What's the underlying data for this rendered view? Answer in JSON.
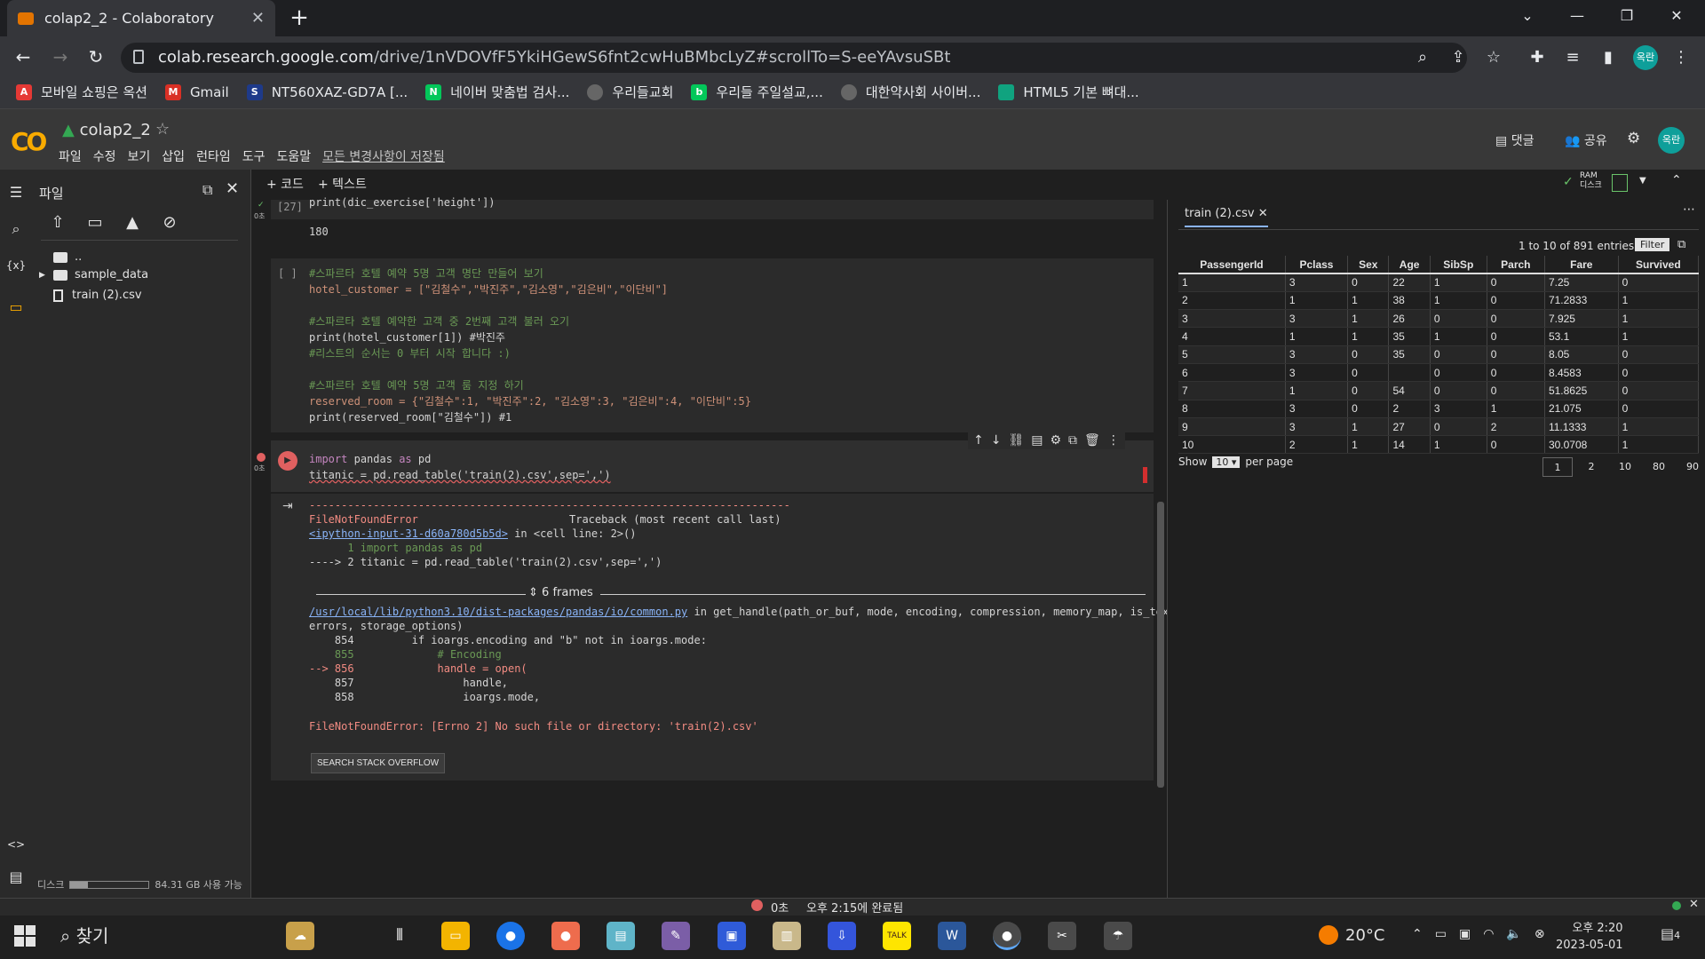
{
  "browser": {
    "tab_title": "colap2_2 - Colaboratory",
    "url_host": "colab.research.google.com",
    "url_path": "/drive/1nVDOVfF5YkiHGewS6fnt2cwHuBMbcLyZ#scrollTo=S-eeYAvsuSBt",
    "profile": "옥란",
    "bookmarks": [
      "모바일 쇼핑은 옥션",
      "Gmail",
      "NT560XAZ-GD7A [...",
      "네이버 맞춤법 검사...",
      "우리들교회",
      "우리들 주일설교,...",
      "대한약사회 사이버...",
      "HTML5 기본 뼈대..."
    ]
  },
  "colab": {
    "logo": "CO",
    "title": "colap2_2",
    "menus": [
      "파일",
      "수정",
      "보기",
      "삽입",
      "런타임",
      "도구",
      "도움말"
    ],
    "saved_status": "모든 변경사항이 저장됨",
    "comment": "댓글",
    "share": "공유",
    "avatar": "옥란",
    "ram_label": "RAM",
    "disk_label": "디스크",
    "add_code": "+ 코드",
    "add_text": "+ 텍스트"
  },
  "files": {
    "title": "파일",
    "items": [
      "..",
      "sample_data",
      "train (2).csv"
    ],
    "disk_label": "디스크",
    "disk_avail": "84.31 GB 사용 가능",
    "disk_used_fraction": 0.22
  },
  "cells": {
    "c1_count": "[27]",
    "c1_time": "0초",
    "c1_code": "print(dic_exercise['height'])",
    "c1_output": "180",
    "c2_prompt": "[ ]",
    "c2_lines": [
      "#스파르타 호텔 예약 5명 고객 명단 만들어 보기",
      "hotel_customer = [\"김철수\",\"박진주\",\"김소영\",\"김은비\",\"이단비\"]",
      "",
      "#스파르타 호텔 예약한 고객 중 2번째 고객 불러 오기",
      "print(hotel_customer[1]) #박진주",
      "#리스트의 순서는 0 부터 시작 합니다 :)",
      "",
      "#스파르타 호텔 예약 5명 고객 룸 지정 하기",
      "reserved_room = {\"김철수\":1, \"박진주\":2, \"김소영\":3, \"김은비\":4, \"이단비\":5}",
      "print(reserved_room[\"김철수\"]) #1"
    ],
    "c3_time": "0초",
    "c3_line1": "import pandas as pd",
    "c3_line2": "titanic = pd.read_table('train(2).csv',sep=',')",
    "tb_rule": "---------------------------------------------------------------------------",
    "tb_error": "FileNotFoundError",
    "tb_header": "Traceback (most recent call last)",
    "tb_input_link": "<ipython-input-31-d60a780d5b5d>",
    "tb_input_where": " in <cell line: 2>()",
    "tb_l1": "      1 import pandas as pd",
    "tb_l2": "----> 2 titanic = pd.read_table('train(2).csv',sep=',')",
    "frames": "6 frames",
    "tb_path": "/usr/local/lib/python3.10/dist-packages/pandas/io/common.py",
    "tb_func": " in get_handle(path_or_buf, mode, encoding, compression, memory_map, is_text,",
    "tb_func2": "errors, storage_options)",
    "tb_src": [
      "    854         if ioargs.encoding and \"b\" not in ioargs.mode:",
      "    855             # Encoding",
      "--> 856             handle = open(",
      "    857                 handle,",
      "    858                 ioargs.mode,"
    ],
    "tb_final": "FileNotFoundError: [Errno 2] No such file or directory: 'train(2).csv'",
    "so_button": "SEARCH STACK OVERFLOW"
  },
  "datapanel": {
    "tab": "train (2).csv",
    "entries": "1 to 10 of 891 entries",
    "filter": "Filter",
    "columns": [
      "PassengerId",
      "Pclass",
      "Sex",
      "Age",
      "SibSp",
      "Parch",
      "Fare",
      "Survived"
    ],
    "rows": [
      [
        "1",
        "3",
        "0",
        "22",
        "1",
        "0",
        "7.25",
        "0"
      ],
      [
        "2",
        "1",
        "1",
        "38",
        "1",
        "0",
        "71.2833",
        "1"
      ],
      [
        "3",
        "3",
        "1",
        "26",
        "0",
        "0",
        "7.925",
        "1"
      ],
      [
        "4",
        "1",
        "1",
        "35",
        "1",
        "0",
        "53.1",
        "1"
      ],
      [
        "5",
        "3",
        "0",
        "35",
        "0",
        "0",
        "8.05",
        "0"
      ],
      [
        "6",
        "3",
        "0",
        "",
        "0",
        "0",
        "8.4583",
        "0"
      ],
      [
        "7",
        "1",
        "0",
        "54",
        "0",
        "0",
        "51.8625",
        "0"
      ],
      [
        "8",
        "3",
        "0",
        "2",
        "3",
        "1",
        "21.075",
        "0"
      ],
      [
        "9",
        "3",
        "1",
        "27",
        "0",
        "2",
        "11.1333",
        "1"
      ],
      [
        "10",
        "2",
        "1",
        "14",
        "1",
        "0",
        "30.0708",
        "1"
      ]
    ],
    "show": "Show",
    "show_value": "10",
    "per_page": "per page",
    "pages": [
      "1",
      "2",
      "10",
      "80",
      "90"
    ]
  },
  "status": {
    "time": "0초",
    "completed": "오후 2:15에 완료됨"
  },
  "taskbar": {
    "search": "찾기",
    "weather": "20°C",
    "time": "오후 2:20",
    "date": "2023-05-01",
    "notif_count": "4"
  }
}
